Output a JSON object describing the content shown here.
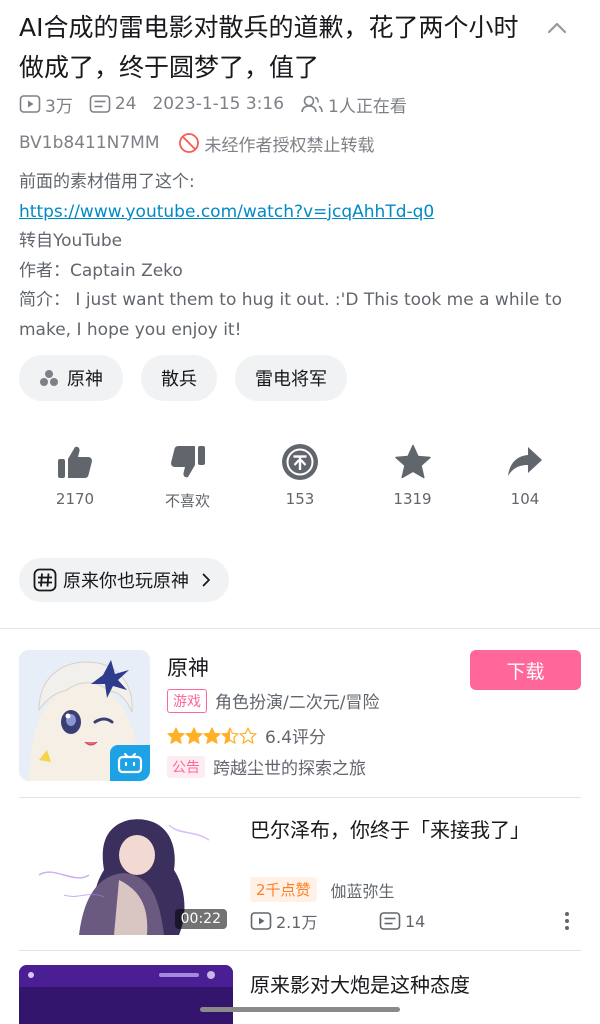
{
  "video": {
    "title": "AI合成的雷电影对散兵的道歉，花了两个小时做成了，终于圆梦了，值了",
    "plays": "3万",
    "danmaku": "24",
    "date": "2023-1-15 3:16",
    "watching": "1人正在看",
    "bvid": "BV1b8411N7MM",
    "copyright_notice": "未经作者授权禁止转载"
  },
  "description": {
    "line1": "前面的素材借用了这个:",
    "link": "https://www.youtube.com/watch?v=jcqAhhTd-q0",
    "line3": "转自YouTube",
    "line4": "作者：Captain Zeko",
    "line5": "简介：  I just want them to hug it out. :'D This took me a while to make, I hope you enjoy it!"
  },
  "tags": [
    "原神",
    "散兵",
    "雷电将军"
  ],
  "actions": {
    "like": "2170",
    "dislike": "不喜欢",
    "coin": "153",
    "favorite": "1319",
    "share": "104"
  },
  "topic": {
    "label": "原来你也玩原神"
  },
  "game": {
    "name": "原神",
    "download_label": "下载",
    "type_badge": "游戏",
    "genres": "角色扮演/二次元/冒险",
    "rating": "6.4评分",
    "rating_stars": 3.5,
    "notice_badge": "公告",
    "notice_text": "跨越尘世的探索之旅"
  },
  "recommendations": [
    {
      "title": "巴尔泽布，你终于「来接我了」",
      "duration": "00:22",
      "hot_badge": "2千点赞",
      "uploader": "伽蓝弥生",
      "plays": "2.1万",
      "danmaku": "14"
    },
    {
      "title": "原来影对大炮是这种态度"
    }
  ],
  "colors": {
    "accent_pink": "#ff6699",
    "link_blue": "#008ac5",
    "hot_orange": "#ff7f24",
    "icon_gray": "#61666d",
    "star_gold": "#ffb027"
  },
  "icons": {
    "collapse": "chevron-up-icon",
    "plays": "play-box-icon",
    "danmaku": "danmaku-icon",
    "watching": "people-icon",
    "nocopy": "prohibited-icon",
    "like": "thumb-up-icon",
    "dislike": "thumb-down-icon",
    "coin": "coin-icon",
    "favorite": "star-icon",
    "share": "share-arrow-icon",
    "topic": "hashtag-icon",
    "more": "more-vertical-icon"
  }
}
